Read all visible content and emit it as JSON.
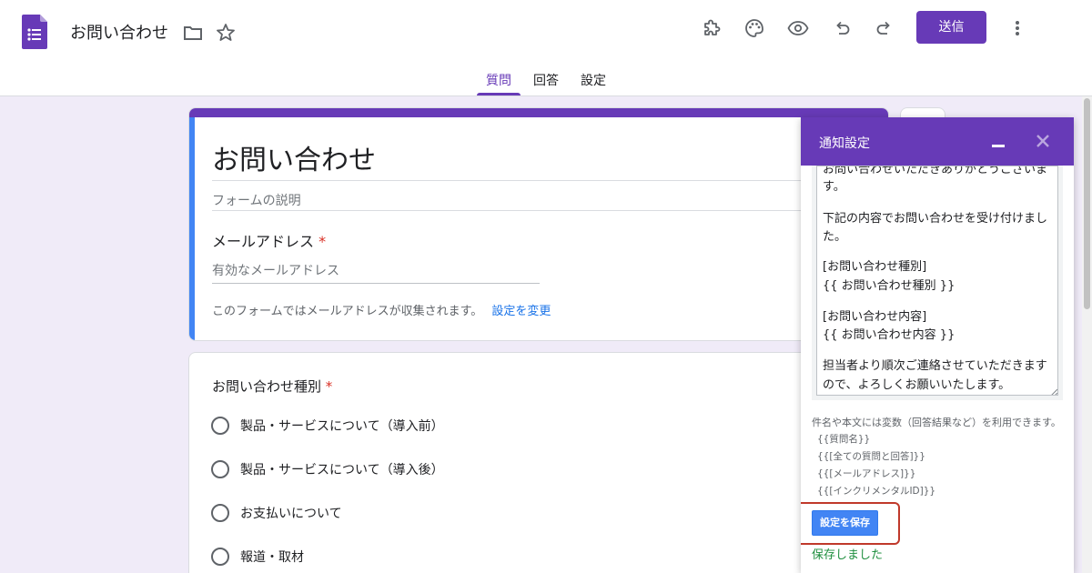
{
  "header": {
    "doc_title": "お問い合わせ",
    "send_label": "送信",
    "icons": [
      "addon-puzzle-icon",
      "palette-icon",
      "preview-eye-icon",
      "undo-icon",
      "redo-icon",
      "more-vert-icon"
    ]
  },
  "tabs": [
    {
      "label": "質問",
      "active": true
    },
    {
      "label": "回答",
      "active": false
    },
    {
      "label": "設定",
      "active": false
    }
  ],
  "form": {
    "title": "お問い合わせ",
    "description_placeholder": "フォームの説明",
    "email_label": "メールアドレス",
    "required_mark": "*",
    "email_placeholder": "有効なメールアドレス",
    "collect_note": "このフォームではメールアドレスが収集されます。",
    "change_settings_link": "設定を変更"
  },
  "question": {
    "title": "お問い合わせ種別",
    "required_mark": "*",
    "options": [
      "製品・サービスについて（導入前）",
      "製品・サービスについて（導入後）",
      "お支払いについて",
      "報道・取材"
    ]
  },
  "panel": {
    "title": "通知設定",
    "message_lines": [
      "お問い合わせいただきありがとうございま",
      "す。",
      "",
      "下記の内容でお問い合わせを受け付けまし",
      "た。",
      "",
      "[お問い合わせ種別]",
      "{{ お問い合わせ種別 }}",
      "",
      "[お問い合わせ内容]",
      "{{ お問い合わせ内容 }}",
      "",
      "担当者より順次ご連絡させていただきます",
      "ので、よろしくお願いいたします。"
    ],
    "vars_note": "件名や本文には変数（回答結果など）を利用できます。",
    "vars": [
      "{{質問名}}",
      "{{[全ての質問と回答]}}",
      "{{[メールアドレス]}}",
      "{{[インクリメンタルID]}}"
    ],
    "save_label": "設定を保存",
    "saved_message": "保存しました"
  },
  "colors": {
    "accent": "#673ab7",
    "link": "#1a73e8",
    "success": "#1e8e3e",
    "required": "#d93025",
    "highlight": "#c0392b"
  }
}
